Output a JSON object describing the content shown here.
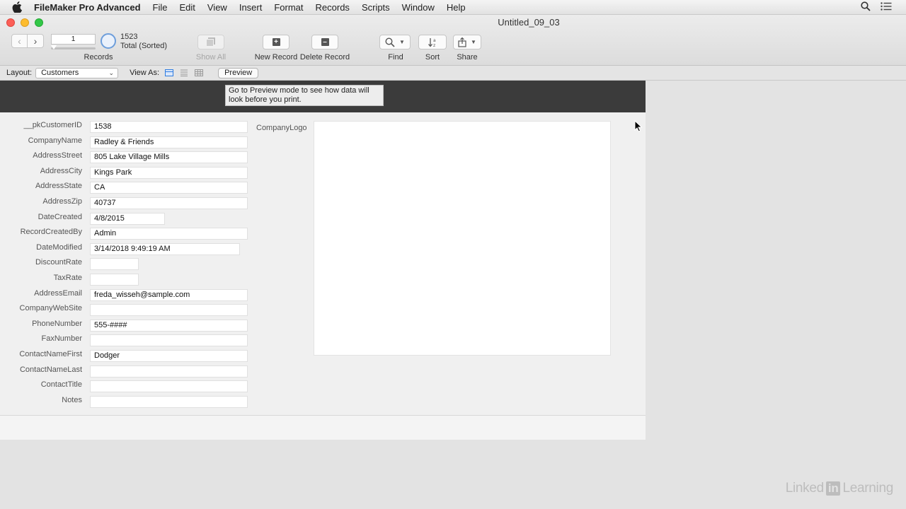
{
  "menubar": {
    "app_name": "FileMaker Pro Advanced",
    "items": [
      "File",
      "Edit",
      "View",
      "Insert",
      "Format",
      "Records",
      "Scripts",
      "Window",
      "Help"
    ]
  },
  "window": {
    "title": "Untitled_09_03"
  },
  "toolbar": {
    "record_number": "1",
    "found_count": "1523",
    "found_status": "Total (Sorted)",
    "records_label": "Records",
    "show_all_label": "Show All",
    "new_record_label": "New Record",
    "delete_record_label": "Delete Record",
    "find_label": "Find",
    "sort_label": "Sort",
    "share_label": "Share"
  },
  "layoutbar": {
    "layout_label": "Layout:",
    "layout_value": "Customers",
    "view_as_label": "View As:",
    "preview_label": "Preview"
  },
  "tooltip": {
    "text": "Go to Preview mode to see how data will look before you print."
  },
  "fields": [
    {
      "label": "__pkCustomerID",
      "value": "1538"
    },
    {
      "label": "CompanyName",
      "value": "Radley & Friends"
    },
    {
      "label": "AddressStreet",
      "value": "805 Lake Village Mills"
    },
    {
      "label": "AddressCity",
      "value": "Kings Park"
    },
    {
      "label": "AddressState",
      "value": "CA"
    },
    {
      "label": "AddressZip",
      "value": "40737"
    },
    {
      "label": "DateCreated",
      "value": "4/8/2015"
    },
    {
      "label": "RecordCreatedBy",
      "value": "Admin"
    },
    {
      "label": "DateModified",
      "value": "3/14/2018 9:49:19 AM"
    },
    {
      "label": "DiscountRate",
      "value": ""
    },
    {
      "label": "TaxRate",
      "value": ""
    },
    {
      "label": "AddressEmail",
      "value": "freda_wisseh@sample.com"
    },
    {
      "label": "CompanyWebSite",
      "value": ""
    },
    {
      "label": "PhoneNumber",
      "value": "555-####"
    },
    {
      "label": "FaxNumber",
      "value": ""
    },
    {
      "label": "ContactNameFirst",
      "value": "Dodger"
    },
    {
      "label": "ContactNameLast",
      "value": ""
    },
    {
      "label": "ContactTitle",
      "value": ""
    },
    {
      "label": "Notes",
      "value": ""
    }
  ],
  "logo_field": {
    "label": "CompanyLogo"
  },
  "watermark": {
    "text_before": "Linked",
    "text_in": "in",
    "text_after": "Learning"
  }
}
